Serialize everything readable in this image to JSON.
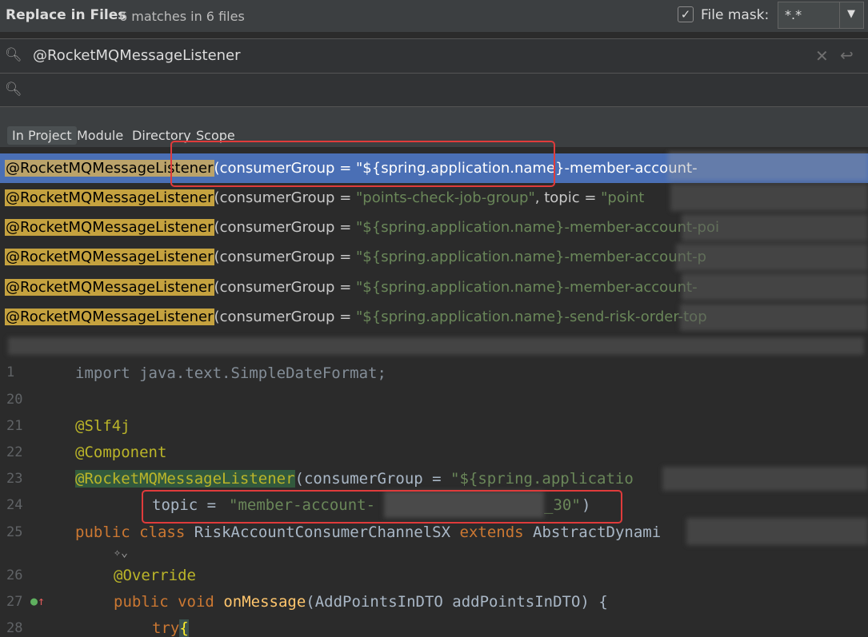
{
  "header": {
    "title": "Replace in Files",
    "matches": "6 matches in 6 files",
    "file_mask_label": "File mask:",
    "file_mask_value": "*.*"
  },
  "search": {
    "query": "@RocketMQMessageListener",
    "replace": ""
  },
  "scopes": [
    "In Project",
    "Module",
    "Directory",
    "Scope"
  ],
  "results": [
    {
      "match": "@RocketMQMessageListener",
      "rest": "(consumerGroup = ",
      "str": "\"${spring.application.name}-member-account-"
    },
    {
      "match": "@RocketMQMessageListener",
      "rest": "(consumerGroup = ",
      "str": "\"points-check-job-group\"",
      "rest2": ", topic = ",
      "str2": "\"point"
    },
    {
      "match": "@RocketMQMessageListener",
      "rest": "(consumerGroup = ",
      "str": "\"${spring.application.name}-member-account-poi"
    },
    {
      "match": "@RocketMQMessageListener",
      "rest": "(consumerGroup = ",
      "str": "\"${spring.application.name}-member-account-p"
    },
    {
      "match": "@RocketMQMessageListener",
      "rest": "(consumerGroup = ",
      "str": "\"${spring.application.name}-member-account-"
    },
    {
      "match": "@RocketMQMessageListener",
      "rest": "(consumerGroup = ",
      "str": "\"${spring.application.name}-send-risk-order-top"
    }
  ],
  "editor": {
    "line_numbers": [
      "1",
      "20",
      "21",
      "22",
      "23",
      "24",
      "25",
      "26",
      "27",
      "28"
    ],
    "line1": "import java.text.SimpleDateFormat;",
    "ann_slf4j": "@Slf4j",
    "ann_component": "@Component",
    "ann_listener": "@RocketMQMessageListener",
    "line23_rest": "(consumerGroup = ",
    "line23_str": "\"${spring.applicatio",
    "line24_key": "topic = ",
    "line24_str_a": "\"member-account-",
    "line24_str_b": "_30\"",
    "line24_end": ")",
    "kw_public": "public",
    "kw_class": "class",
    "class_name": "RiskAccountConsumerChannelSX",
    "kw_extends": "extends",
    "super_class": "AbstractDynami",
    "ann_override": "@Override",
    "kw_void": "void",
    "method": "onMessage",
    "params": "(AddPointsInDTO addPointsInDTO) {",
    "kw_try": "try",
    "brace": "{"
  }
}
